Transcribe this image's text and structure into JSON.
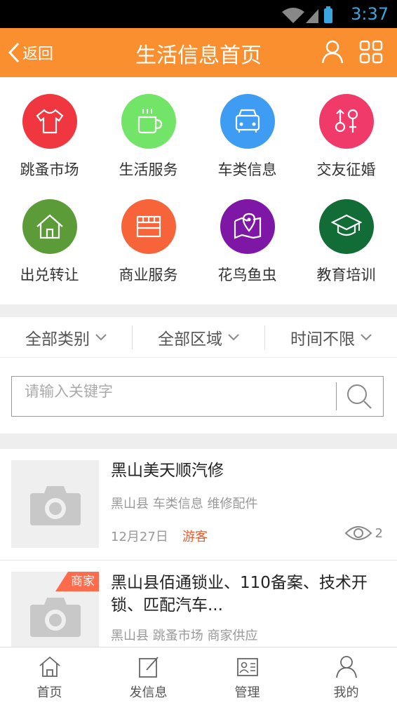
{
  "statusbar": {
    "time": "3:37"
  },
  "header": {
    "back_label": "返回",
    "title": "生活信息首页"
  },
  "categories": [
    {
      "label": "跳蚤市场",
      "icon": "tshirt-icon",
      "color": "#f0363e"
    },
    {
      "label": "生活服务",
      "icon": "coffee-cup-icon",
      "color": "#72e467"
    },
    {
      "label": "车类信息",
      "icon": "car-icon",
      "color": "#3e9df2"
    },
    {
      "label": "交友征婚",
      "icon": "gender-icon",
      "color": "#f03a6a"
    },
    {
      "label": "出兑转让",
      "icon": "house-icon",
      "color": "#5c9c38"
    },
    {
      "label": "商业服务",
      "icon": "shop-icon",
      "color": "#f7643a"
    },
    {
      "label": "花鸟鱼虫",
      "icon": "map-pin-icon",
      "color": "#7e17a6"
    },
    {
      "label": "教育培训",
      "icon": "graduation-cap-icon",
      "color": "#116c35"
    }
  ],
  "filters": [
    "全部类别",
    "全部区域",
    "时间不限"
  ],
  "search": {
    "placeholder": "请输入关键字"
  },
  "listings": [
    {
      "title": "黑山美天顺汽修",
      "meta": "黑山县 车类信息 维修配件",
      "date": "12月27日",
      "tag": "游客",
      "views": "2",
      "badge": ""
    },
    {
      "title": "黑山县佰通锁业、110备案、技术开锁、匹配汽车...",
      "meta": "黑山县 跳蚤市场 商家供应",
      "badge": "商家"
    }
  ],
  "tabbar": [
    {
      "label": "首页",
      "icon": "home-icon"
    },
    {
      "label": "发信息",
      "icon": "edit-icon"
    },
    {
      "label": "管理",
      "icon": "id-card-icon"
    },
    {
      "label": "我的",
      "icon": "user-icon"
    }
  ],
  "colors": {
    "header": "#f98f2f",
    "accent_tag": "#f05a2a",
    "badge": "#ff6b4d"
  }
}
